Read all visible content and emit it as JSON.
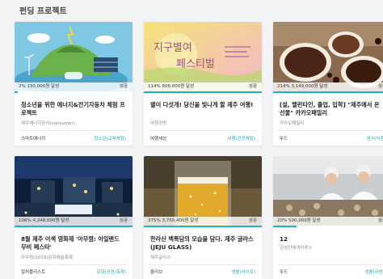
{
  "section": {
    "title": "펀딩 프로젝트"
  },
  "colors": {
    "accent": "#17b5c5",
    "category": "#2aa7b5"
  },
  "cards": [
    {
      "percent_label": "2%",
      "amount_label": "130,000원 달성",
      "progress": 0.02,
      "state": "성공",
      "title": "청소년을 위한 에너지&전기자동차 체험 프로젝트",
      "subtitle": "제주에너지공사(consumer)",
      "maker": "스마트에너지",
      "category": "청소년(교육체험)"
    },
    {
      "percent_label": "114%",
      "amount_label": "606,000원 달성",
      "progress": 1.0,
      "state": "성공",
      "title": "별이 다섯개! 당신을 빛나게 할 제주 여행!",
      "subtitle": "여행공방",
      "maker": "여행세상",
      "category": "여행(관광체험)"
    },
    {
      "percent_label": "214%",
      "amount_label": "3,149,000원 달성",
      "progress": 1.0,
      "state": "성공",
      "title": "[설, 밸런타인, 졸업, 입학] \"제주에서 온 선물\" 카카오패밀리",
      "subtitle": "카카오패밀리",
      "maker": "뚜드",
      "category": "음식/식품"
    },
    {
      "percent_label": "106%",
      "amount_label": "4,248,000원 달성",
      "progress": 1.0,
      "state": "성공",
      "title": "8월 제주 이색 영화제 '아무렴: 아일랜드 무비 페스타'",
      "subtitle": "아무렴(2019)문화예술축제",
      "maker": "컬처플러스트",
      "category": "문화(공연/축제)"
    },
    {
      "percent_label": "375%",
      "amount_label": "3,750,400원 달성",
      "progress": 1.0,
      "state": "성공",
      "title": "한라산 백록담의 모습을 담다. 제주 글라스(JEJU GLASS)",
      "subtitle": "제주글라스",
      "maker": "올리브",
      "category": "생활(라이프)"
    },
    {
      "percent_label": "20%",
      "amount_label": "500,000원 달성",
      "progress": 0.2,
      "state": "성공",
      "title": "12",
      "subtitle": "김성진에게이루스",
      "maker": "뚜드",
      "category": "생활(리빙)"
    }
  ]
}
